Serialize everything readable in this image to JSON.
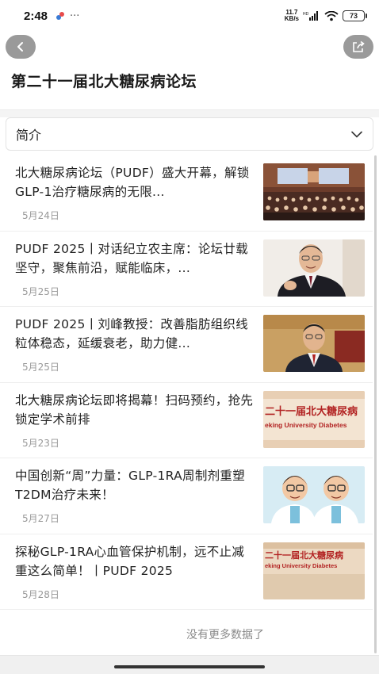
{
  "status": {
    "time": "2:48",
    "dots": "···",
    "net_speed_value": "11.7",
    "net_speed_unit": "KB/s",
    "battery": "73"
  },
  "page": {
    "title": "第二十一届北大糖尿病论坛"
  },
  "section_dropdown": {
    "label": "简介"
  },
  "articles": [
    {
      "title": "北大糖尿病论坛（PUDF）盛大开幕，解锁GLP-1治疗糖尿病的无限...",
      "date": "5月24日",
      "thumb": "conference-hall-photo"
    },
    {
      "title": "PUDF 2025丨对话纪立农主席：论坛廿载坚守，聚焦前沿，赋能临床，...",
      "date": "5月25日",
      "thumb": "speaker-portrait-photo"
    },
    {
      "title": "PUDF 2025丨刘峰教授：改善脂肪组织线粒体稳态，延缓衰老，助力健...",
      "date": "5月25日",
      "thumb": "professor-portrait-photo"
    },
    {
      "title": "北大糖尿病论坛即将揭幕！扫码预约，抢先锁定学术前排",
      "date": "5月23日",
      "thumb": "forum-banner-image"
    },
    {
      "title": "中国创新“周”力量：GLP-1RA周制剂重塑T2DM治疗未来！",
      "date": "5月27日",
      "thumb": "cartoon-doctors-image"
    },
    {
      "title": "探秘GLP-1RA心血管保护机制，远不止减重这么简单！丨PUDF 2025",
      "date": "5月28日",
      "thumb": "forum-banner-image-2"
    }
  ],
  "thumb_texts": {
    "banner_cn": "二十一届北大糖尿病",
    "banner_en": "eking University Diabetes"
  },
  "footer": {
    "no_more": "没有更多数据了"
  },
  "colors": {
    "banner_red": "#b22222",
    "nav_button_gray": "#9a9a9a"
  }
}
